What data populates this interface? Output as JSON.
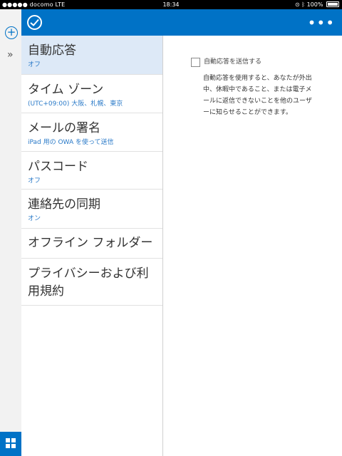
{
  "status_bar": {
    "carrier": "●●●●● docomo  LTE",
    "time": "18:34",
    "battery": "100%"
  },
  "top_bar": {
    "more_label": "•••"
  },
  "settings_list": [
    {
      "title": "自動応答",
      "subtitle": "オフ"
    },
    {
      "title": "タイム ゾーン",
      "subtitle": "(UTC+09:00) 大阪、札幌、東京"
    },
    {
      "title": "メールの署名",
      "subtitle": "iPad 用の OWA を使って送信"
    },
    {
      "title": "パスコード",
      "subtitle": "オフ"
    },
    {
      "title": "連絡先の同期",
      "subtitle": "オン"
    },
    {
      "title": "オフライン フォルダー"
    },
    {
      "title": "プライバシーおよび利用規約"
    }
  ],
  "auto_reply": {
    "checkbox_label": "自動応答を送信する",
    "description": "自動応答を使用すると、あなたが外出中、休暇中であること、または電子メールに返信できないことを他のユーザーに知らせることができます。"
  },
  "colors": {
    "accent": "#0072c6",
    "selected_row": "#dde9f7",
    "subtitle": "#2a7ac8"
  },
  "icons": [
    "add-icon",
    "expand-icon",
    "checkmark-icon",
    "more-icon",
    "app-launcher-icon",
    "bluetooth-icon",
    "lock-rotation-icon",
    "battery-icon"
  ]
}
